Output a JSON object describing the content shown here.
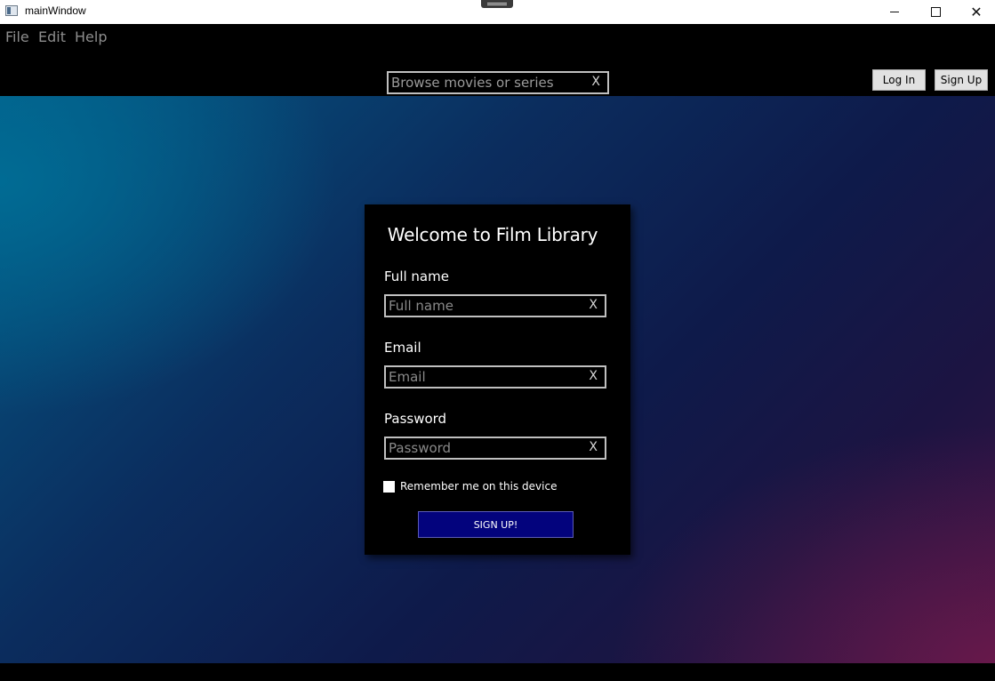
{
  "window": {
    "title": "mainWindow",
    "controls": {
      "minimize_icon": "minimize-icon",
      "maximize_icon": "maximize-icon",
      "close_glyph": "✕"
    }
  },
  "menu": {
    "items": [
      "File",
      "Edit",
      "Help"
    ]
  },
  "header": {
    "search": {
      "placeholder": "Browse movies or series",
      "value": "",
      "clear_label": "X"
    },
    "login_label": "Log In",
    "signup_label": "Sign Up"
  },
  "form": {
    "title": "Welcome to Film Library",
    "fields": [
      {
        "label": "Full name",
        "placeholder": "Full name",
        "value": "",
        "clear_label": "X"
      },
      {
        "label": "Email",
        "placeholder": "Email",
        "value": "",
        "clear_label": "X"
      },
      {
        "label": "Password",
        "placeholder": "Password",
        "value": "",
        "clear_label": "X"
      }
    ],
    "remember": {
      "label": "Remember me on this device",
      "checked": false
    },
    "submit_label": "SIGN UP!"
  },
  "colors": {
    "submit_bg": "#03037d",
    "background_gradient_start": "#035a86",
    "background_gradient_end": "#3a1244"
  }
}
